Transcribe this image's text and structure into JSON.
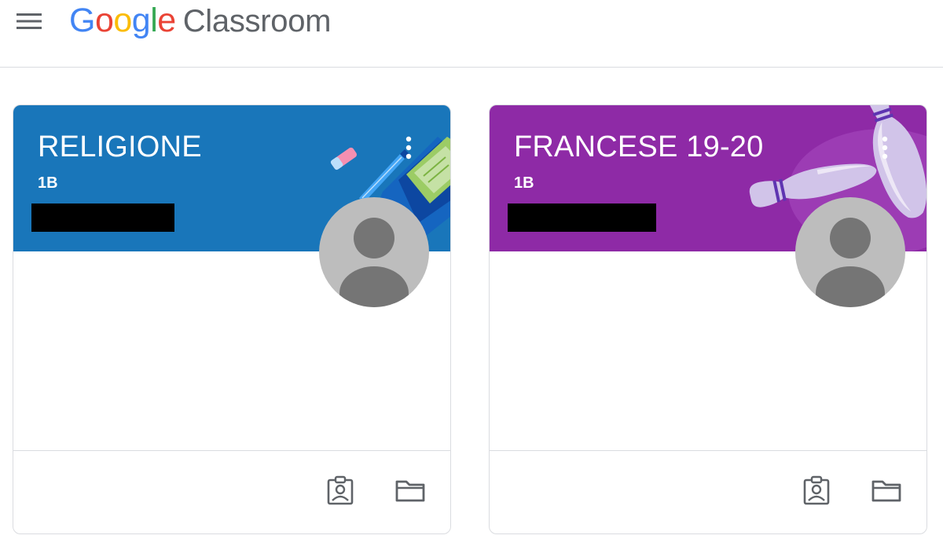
{
  "header": {
    "logo_google_letters": [
      "G",
      "o",
      "o",
      "g",
      "l",
      "e"
    ],
    "logo_product": "Classroom"
  },
  "cards": [
    {
      "title": "RELIGIONE",
      "section": "1B",
      "header_color": "#1976ba"
    },
    {
      "title": "FRANCESE 19-20",
      "section": "1B",
      "header_color": "#8e2aa6"
    }
  ],
  "icons": {
    "menu": "hamburger-menu-icon",
    "more": "more-vert-icon",
    "work": "assignment-ind-icon",
    "folder": "folder-icon",
    "avatar": "person-silhouette-icon"
  },
  "colors": {
    "google_blue": "#4285f4",
    "google_red": "#ea4335",
    "google_yellow": "#fbbc05",
    "google_green": "#34a853",
    "product_grey": "#5f6368",
    "divider": "#dadce0"
  }
}
